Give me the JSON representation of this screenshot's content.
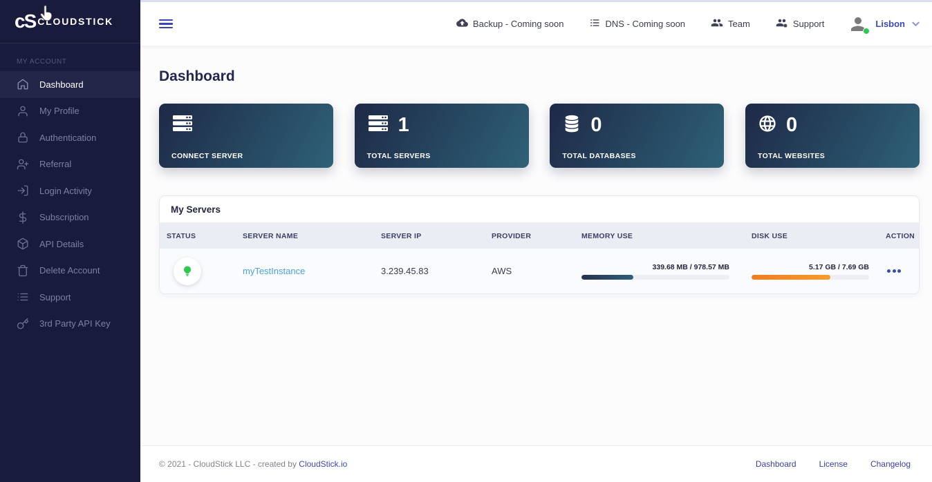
{
  "brand": {
    "mark": "cS",
    "name": "CLOUDSTICK"
  },
  "sidebar": {
    "section_label": "MY ACCOUNT",
    "items": [
      {
        "label": "Dashboard",
        "icon": "home-icon",
        "active": true
      },
      {
        "label": "My Profile",
        "icon": "user-icon",
        "active": false
      },
      {
        "label": "Authentication",
        "icon": "lock-icon",
        "active": false
      },
      {
        "label": "Referral",
        "icon": "user-plus-icon",
        "active": false
      },
      {
        "label": "Login Activity",
        "icon": "login-icon",
        "active": false
      },
      {
        "label": "Subscription",
        "icon": "dollar-icon",
        "active": false
      },
      {
        "label": "API Details",
        "icon": "package-icon",
        "active": false
      },
      {
        "label": "Delete Account",
        "icon": "trash-icon",
        "active": false
      },
      {
        "label": "Support",
        "icon": "list-icon",
        "active": false
      },
      {
        "label": "3rd Party API Key",
        "icon": "key-icon",
        "active": false
      }
    ]
  },
  "header": {
    "nav": [
      {
        "label": "Backup - Coming soon",
        "icon": "cloud-backup-icon"
      },
      {
        "label": "DNS - Coming soon",
        "icon": "dns-list-icon"
      },
      {
        "label": "Team",
        "icon": "team-icon"
      },
      {
        "label": "Support",
        "icon": "support-users-icon"
      }
    ],
    "user": {
      "name": "Lisbon",
      "status": "online"
    }
  },
  "page": {
    "title": "Dashboard"
  },
  "stat_cards": [
    {
      "label": "CONNECT SERVER",
      "value": "",
      "icon": "server-rack-icon"
    },
    {
      "label": "TOTAL SERVERS",
      "value": "1",
      "icon": "server-rack-icon"
    },
    {
      "label": "TOTAL DATABASES",
      "value": "0",
      "icon": "database-icon"
    },
    {
      "label": "TOTAL WEBSITES",
      "value": "0",
      "icon": "globe-icon"
    }
  ],
  "servers_table": {
    "title": "My Servers",
    "columns": [
      "STATUS",
      "SERVER NAME",
      "SERVER IP",
      "PROVIDER",
      "MEMORY USE",
      "DISK USE",
      "ACTION"
    ],
    "rows": [
      {
        "status": "online",
        "server_name": "myTestInstance",
        "server_ip": "3.239.45.83",
        "provider": "AWS",
        "memory": {
          "label": "339.68 MB / 978.57 MB",
          "percent": 35
        },
        "disk": {
          "label": "5.17 GB / 7.69 GB",
          "percent": 67
        }
      }
    ]
  },
  "footer": {
    "copyright": "© 2021 - CloudStick LLC - created by",
    "brand_link": "CloudStick.io",
    "links": [
      "Dashboard",
      "License",
      "Changelog"
    ]
  },
  "colors": {
    "sidebar_bg": "#191b3c",
    "accent_indigo": "#3c4ab2",
    "card_gradient_start": "#1e2947",
    "card_gradient_end": "#2e6177",
    "status_green": "#2fc94f",
    "disk_orange": "#f5821f",
    "memory_bar_end": "#2e5f7b",
    "link_blue": "#4aa0e0"
  }
}
